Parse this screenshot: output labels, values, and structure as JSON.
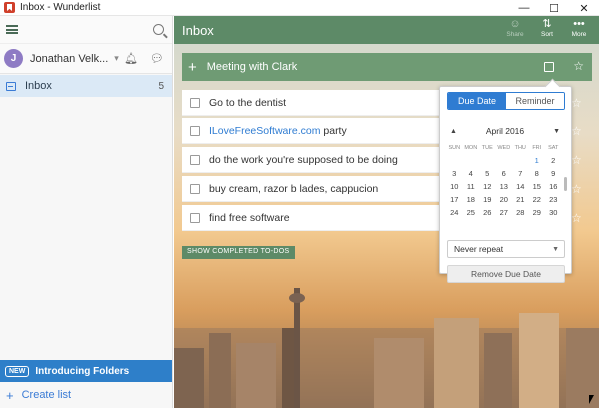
{
  "window": {
    "title": "Inbox - Wunderlist",
    "controls": {
      "minimize": "—",
      "maximize": "☐",
      "close": "✕"
    }
  },
  "sidebar": {
    "user": {
      "initial": "J",
      "name": "Jonathan Velk...",
      "avatar_color": "#8e7bc4"
    },
    "inbox": {
      "label": "Inbox",
      "count": "5"
    },
    "banner": {
      "badge": "NEW",
      "label": "Introducing Folders"
    },
    "create_list": {
      "label": "Create list"
    }
  },
  "main": {
    "title": "Inbox",
    "tools": [
      {
        "icon": "share-icon",
        "label": "Share"
      },
      {
        "icon": "sort-icon",
        "label": "Sort"
      },
      {
        "icon": "more-icon",
        "label": "More"
      }
    ],
    "add_todo": {
      "value": "Meeting with Clark"
    },
    "todos": [
      {
        "text": "Go to the dentist"
      },
      {
        "link": "ILoveFreeSoftware.com",
        "text": " party"
      },
      {
        "text": "do the work you're supposed to be doing"
      },
      {
        "text": "buy cream, razor b lades, cappucion"
      },
      {
        "text": "find free software"
      }
    ],
    "show_completed": "SHOW COMPLETED TO-DOS"
  },
  "popover": {
    "tabs": {
      "due_date": "Due Date",
      "reminder": "Reminder"
    },
    "month": "April 2016",
    "prev": "▲",
    "next": "▼",
    "dow": [
      "SUN",
      "MON",
      "TUE",
      "WED",
      "THU",
      "FRI",
      "SAT"
    ],
    "weeks": [
      [
        "",
        "",
        "",
        "",
        "",
        "1",
        "2"
      ],
      [
        "3",
        "4",
        "5",
        "6",
        "7",
        "8",
        "9"
      ],
      [
        "10",
        "11",
        "12",
        "13",
        "14",
        "15",
        "16"
      ],
      [
        "17",
        "18",
        "19",
        "20",
        "21",
        "22",
        "23"
      ],
      [
        "24",
        "25",
        "26",
        "27",
        "28",
        "29",
        "30"
      ]
    ],
    "repeat": "Never repeat",
    "remove": "Remove Due Date"
  },
  "colors": {
    "header": "#5d8a67",
    "accent": "#2f7cd2",
    "banner": "#2e7fc9"
  }
}
